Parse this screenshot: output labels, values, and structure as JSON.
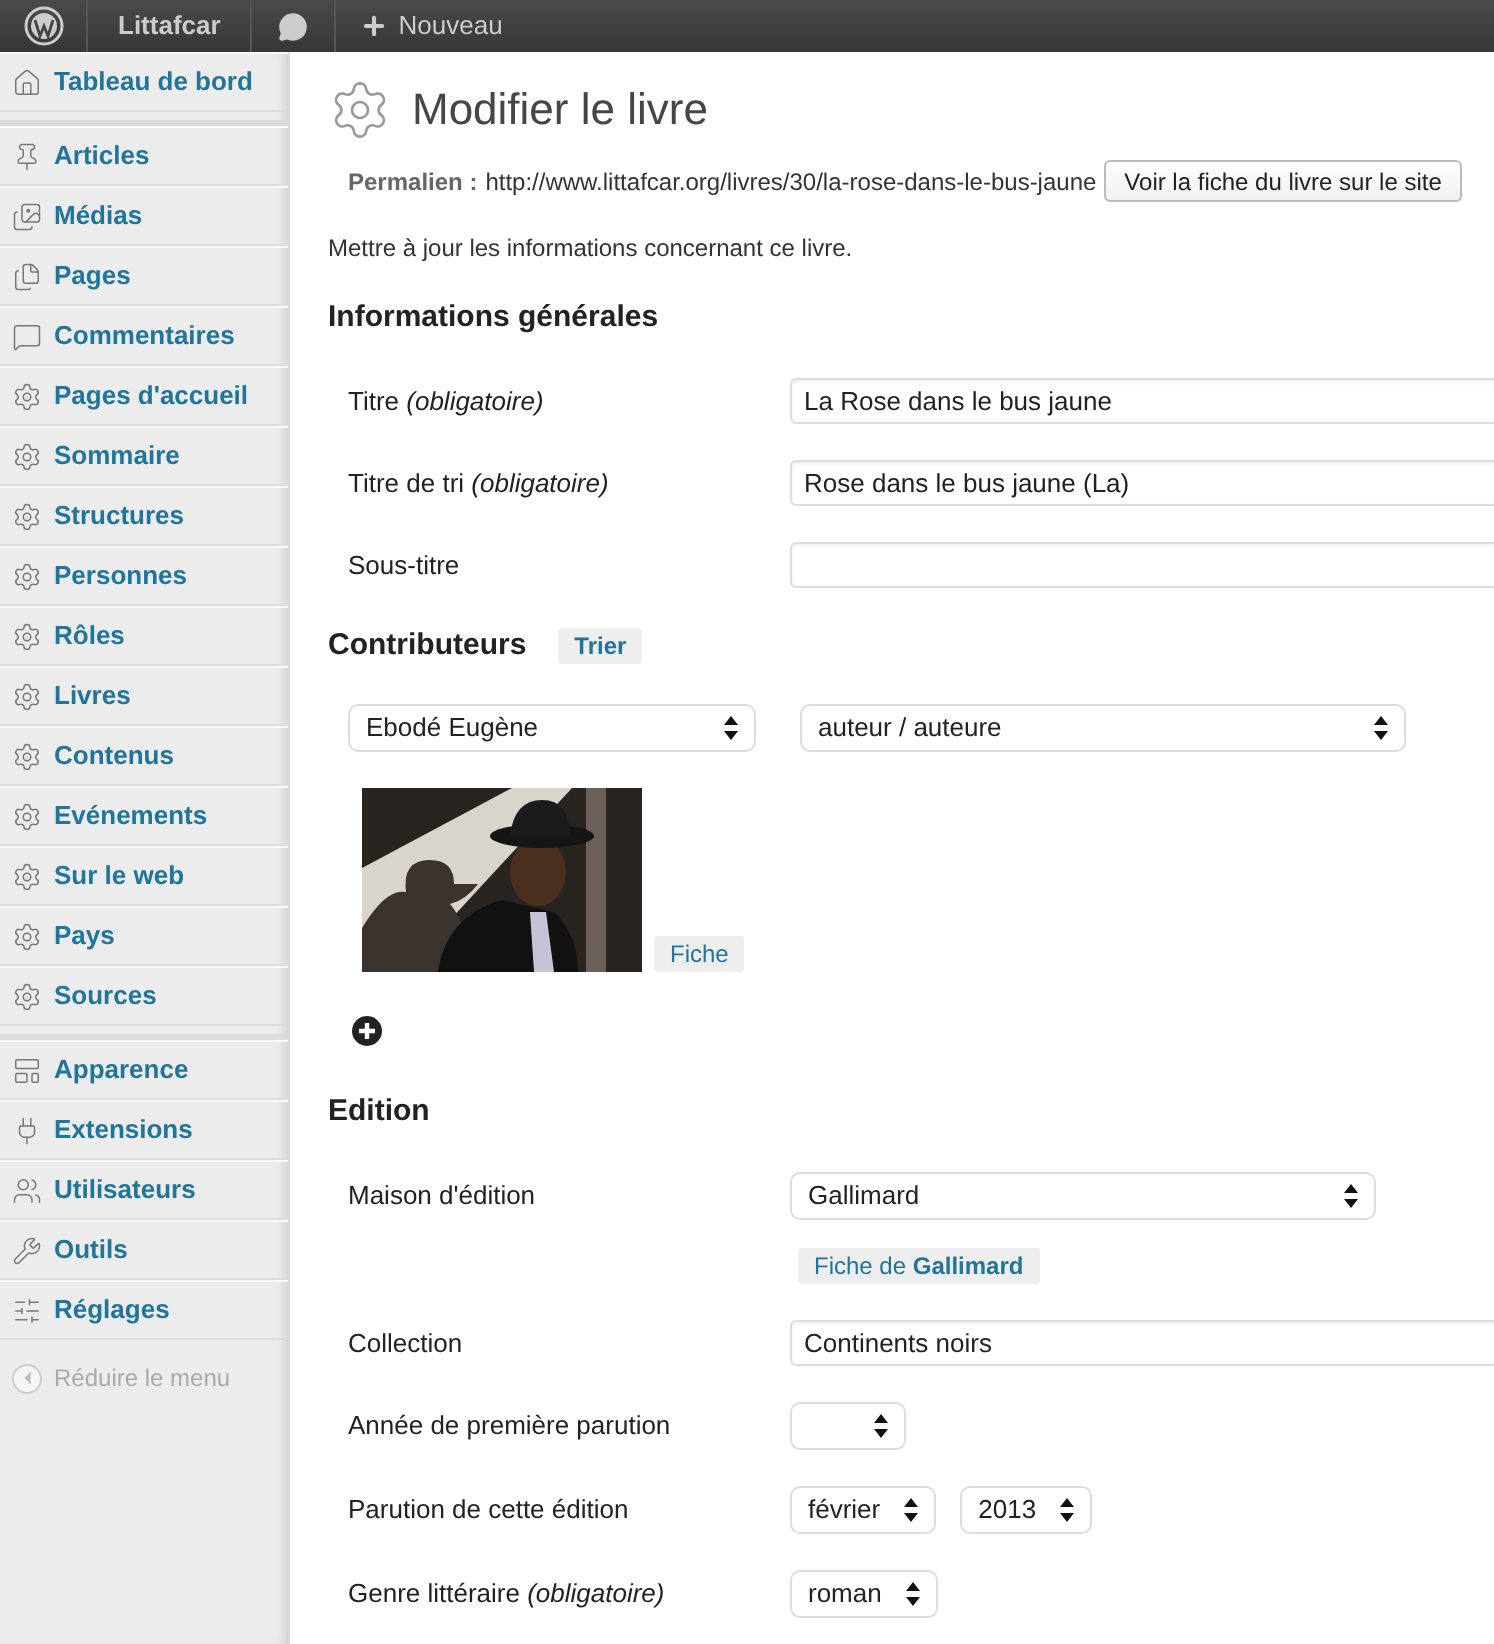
{
  "admin_bar": {
    "site_name": "Littafcar",
    "new_label": "Nouveau"
  },
  "sidebar": {
    "groups": [
      [
        {
          "label": "Tableau de bord",
          "selected": false
        }
      ],
      [
        {
          "label": "Articles",
          "selected": false
        },
        {
          "label": "Médias",
          "selected": false
        },
        {
          "label": "Pages",
          "selected": false
        },
        {
          "label": "Commentaires",
          "selected": false
        },
        {
          "label": "Pages d'accueil",
          "selected": false
        },
        {
          "label": "Sommaire",
          "selected": false
        },
        {
          "label": "Structures",
          "selected": false
        },
        {
          "label": "Personnes",
          "selected": false
        },
        {
          "label": "Rôles",
          "selected": false
        },
        {
          "label": "Livres",
          "selected": false
        },
        {
          "label": "Contenus",
          "selected": false
        },
        {
          "label": "Evénements",
          "selected": false
        },
        {
          "label": "Sur le web",
          "selected": false
        },
        {
          "label": "Pays",
          "selected": false
        },
        {
          "label": "Sources",
          "selected": false
        }
      ],
      [
        {
          "label": "Apparence",
          "selected": false
        },
        {
          "label": "Extensions",
          "selected": false
        },
        {
          "label": "Utilisateurs",
          "selected": false
        },
        {
          "label": "Outils",
          "selected": false
        },
        {
          "label": "Réglages",
          "selected": false
        }
      ]
    ],
    "collapse_label": "Réduire le menu"
  },
  "page": {
    "title": "Modifier le livre",
    "permalink_label": "Permalien :",
    "permalink_url": "http://www.littafcar.org/livres/30/la-rose-dans-le-bus-jaune",
    "view_button": "Voir la fiche du livre sur le site",
    "intro": "Mettre à jour les informations concernant ce livre."
  },
  "sections": [
    {
      "kind": "fields",
      "heading": "Informations générales",
      "fields": [
        {
          "label": "Titre *(obligatoire)*",
          "kind": "text",
          "value": "La Rose dans le bus jaune"
        },
        {
          "label": "Titre de tri *(obligatoire)*",
          "kind": "text",
          "value": "Rose dans le bus jaune (La)"
        },
        {
          "label": "Sous-titre",
          "kind": "text"
        }
      ]
    },
    {
      "kind": "contributors",
      "heading": "Contributeurs",
      "sort_button": "Trier",
      "contributors": [
        {
          "person": "Ebodé Eugène",
          "role": "auteur / auteure",
          "profile_button": "Fiche"
        }
      ]
    },
    {
      "kind": "fields",
      "heading": "Edition",
      "fields": [
        {
          "label": "Maison d'édition",
          "kind": "select_wide",
          "value": "Gallimard",
          "link_button": "Fiche de **Gallimard**"
        },
        {
          "label": "Collection",
          "kind": "text",
          "value": "Continents noirs"
        },
        {
          "label": "Année de première parution",
          "kind": "select_narrow"
        },
        {
          "label": "Parution de cette édition",
          "kind": "select_pair",
          "values": [
            "février",
            "2013"
          ]
        },
        {
          "label": "Genre littéraire *(obligatoire)*",
          "kind": "select_narrow",
          "value": "roman"
        }
      ]
    }
  ]
}
